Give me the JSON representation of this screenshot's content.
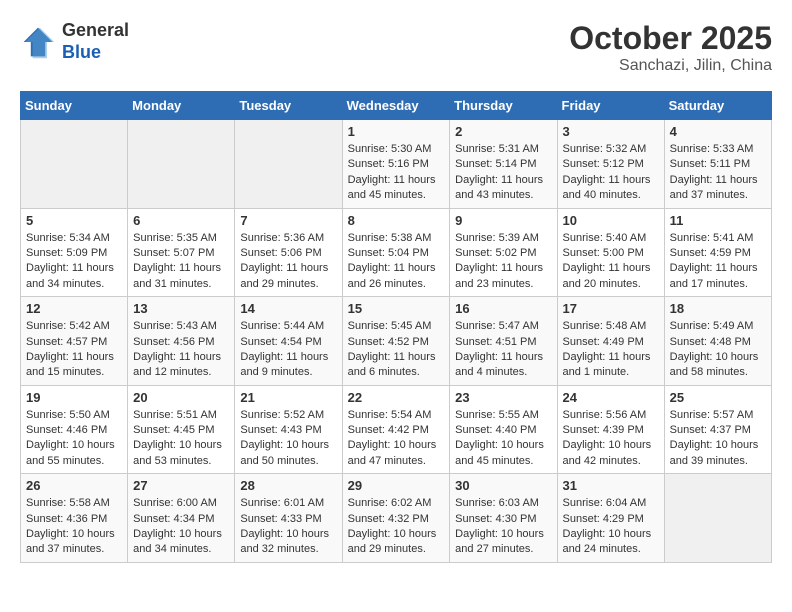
{
  "header": {
    "logo_line1": "General",
    "logo_line2": "Blue",
    "title": "October 2025",
    "subtitle": "Sanchazi, Jilin, China"
  },
  "calendar": {
    "days_of_week": [
      "Sunday",
      "Monday",
      "Tuesday",
      "Wednesday",
      "Thursday",
      "Friday",
      "Saturday"
    ],
    "weeks": [
      [
        {
          "day": "",
          "info": ""
        },
        {
          "day": "",
          "info": ""
        },
        {
          "day": "",
          "info": ""
        },
        {
          "day": "1",
          "info": "Sunrise: 5:30 AM\nSunset: 5:16 PM\nDaylight: 11 hours and 45 minutes."
        },
        {
          "day": "2",
          "info": "Sunrise: 5:31 AM\nSunset: 5:14 PM\nDaylight: 11 hours and 43 minutes."
        },
        {
          "day": "3",
          "info": "Sunrise: 5:32 AM\nSunset: 5:12 PM\nDaylight: 11 hours and 40 minutes."
        },
        {
          "day": "4",
          "info": "Sunrise: 5:33 AM\nSunset: 5:11 PM\nDaylight: 11 hours and 37 minutes."
        }
      ],
      [
        {
          "day": "5",
          "info": "Sunrise: 5:34 AM\nSunset: 5:09 PM\nDaylight: 11 hours and 34 minutes."
        },
        {
          "day": "6",
          "info": "Sunrise: 5:35 AM\nSunset: 5:07 PM\nDaylight: 11 hours and 31 minutes."
        },
        {
          "day": "7",
          "info": "Sunrise: 5:36 AM\nSunset: 5:06 PM\nDaylight: 11 hours and 29 minutes."
        },
        {
          "day": "8",
          "info": "Sunrise: 5:38 AM\nSunset: 5:04 PM\nDaylight: 11 hours and 26 minutes."
        },
        {
          "day": "9",
          "info": "Sunrise: 5:39 AM\nSunset: 5:02 PM\nDaylight: 11 hours and 23 minutes."
        },
        {
          "day": "10",
          "info": "Sunrise: 5:40 AM\nSunset: 5:00 PM\nDaylight: 11 hours and 20 minutes."
        },
        {
          "day": "11",
          "info": "Sunrise: 5:41 AM\nSunset: 4:59 PM\nDaylight: 11 hours and 17 minutes."
        }
      ],
      [
        {
          "day": "12",
          "info": "Sunrise: 5:42 AM\nSunset: 4:57 PM\nDaylight: 11 hours and 15 minutes."
        },
        {
          "day": "13",
          "info": "Sunrise: 5:43 AM\nSunset: 4:56 PM\nDaylight: 11 hours and 12 minutes."
        },
        {
          "day": "14",
          "info": "Sunrise: 5:44 AM\nSunset: 4:54 PM\nDaylight: 11 hours and 9 minutes."
        },
        {
          "day": "15",
          "info": "Sunrise: 5:45 AM\nSunset: 4:52 PM\nDaylight: 11 hours and 6 minutes."
        },
        {
          "day": "16",
          "info": "Sunrise: 5:47 AM\nSunset: 4:51 PM\nDaylight: 11 hours and 4 minutes."
        },
        {
          "day": "17",
          "info": "Sunrise: 5:48 AM\nSunset: 4:49 PM\nDaylight: 11 hours and 1 minute."
        },
        {
          "day": "18",
          "info": "Sunrise: 5:49 AM\nSunset: 4:48 PM\nDaylight: 10 hours and 58 minutes."
        }
      ],
      [
        {
          "day": "19",
          "info": "Sunrise: 5:50 AM\nSunset: 4:46 PM\nDaylight: 10 hours and 55 minutes."
        },
        {
          "day": "20",
          "info": "Sunrise: 5:51 AM\nSunset: 4:45 PM\nDaylight: 10 hours and 53 minutes."
        },
        {
          "day": "21",
          "info": "Sunrise: 5:52 AM\nSunset: 4:43 PM\nDaylight: 10 hours and 50 minutes."
        },
        {
          "day": "22",
          "info": "Sunrise: 5:54 AM\nSunset: 4:42 PM\nDaylight: 10 hours and 47 minutes."
        },
        {
          "day": "23",
          "info": "Sunrise: 5:55 AM\nSunset: 4:40 PM\nDaylight: 10 hours and 45 minutes."
        },
        {
          "day": "24",
          "info": "Sunrise: 5:56 AM\nSunset: 4:39 PM\nDaylight: 10 hours and 42 minutes."
        },
        {
          "day": "25",
          "info": "Sunrise: 5:57 AM\nSunset: 4:37 PM\nDaylight: 10 hours and 39 minutes."
        }
      ],
      [
        {
          "day": "26",
          "info": "Sunrise: 5:58 AM\nSunset: 4:36 PM\nDaylight: 10 hours and 37 minutes."
        },
        {
          "day": "27",
          "info": "Sunrise: 6:00 AM\nSunset: 4:34 PM\nDaylight: 10 hours and 34 minutes."
        },
        {
          "day": "28",
          "info": "Sunrise: 6:01 AM\nSunset: 4:33 PM\nDaylight: 10 hours and 32 minutes."
        },
        {
          "day": "29",
          "info": "Sunrise: 6:02 AM\nSunset: 4:32 PM\nDaylight: 10 hours and 29 minutes."
        },
        {
          "day": "30",
          "info": "Sunrise: 6:03 AM\nSunset: 4:30 PM\nDaylight: 10 hours and 27 minutes."
        },
        {
          "day": "31",
          "info": "Sunrise: 6:04 AM\nSunset: 4:29 PM\nDaylight: 10 hours and 24 minutes."
        },
        {
          "day": "",
          "info": ""
        }
      ]
    ]
  }
}
